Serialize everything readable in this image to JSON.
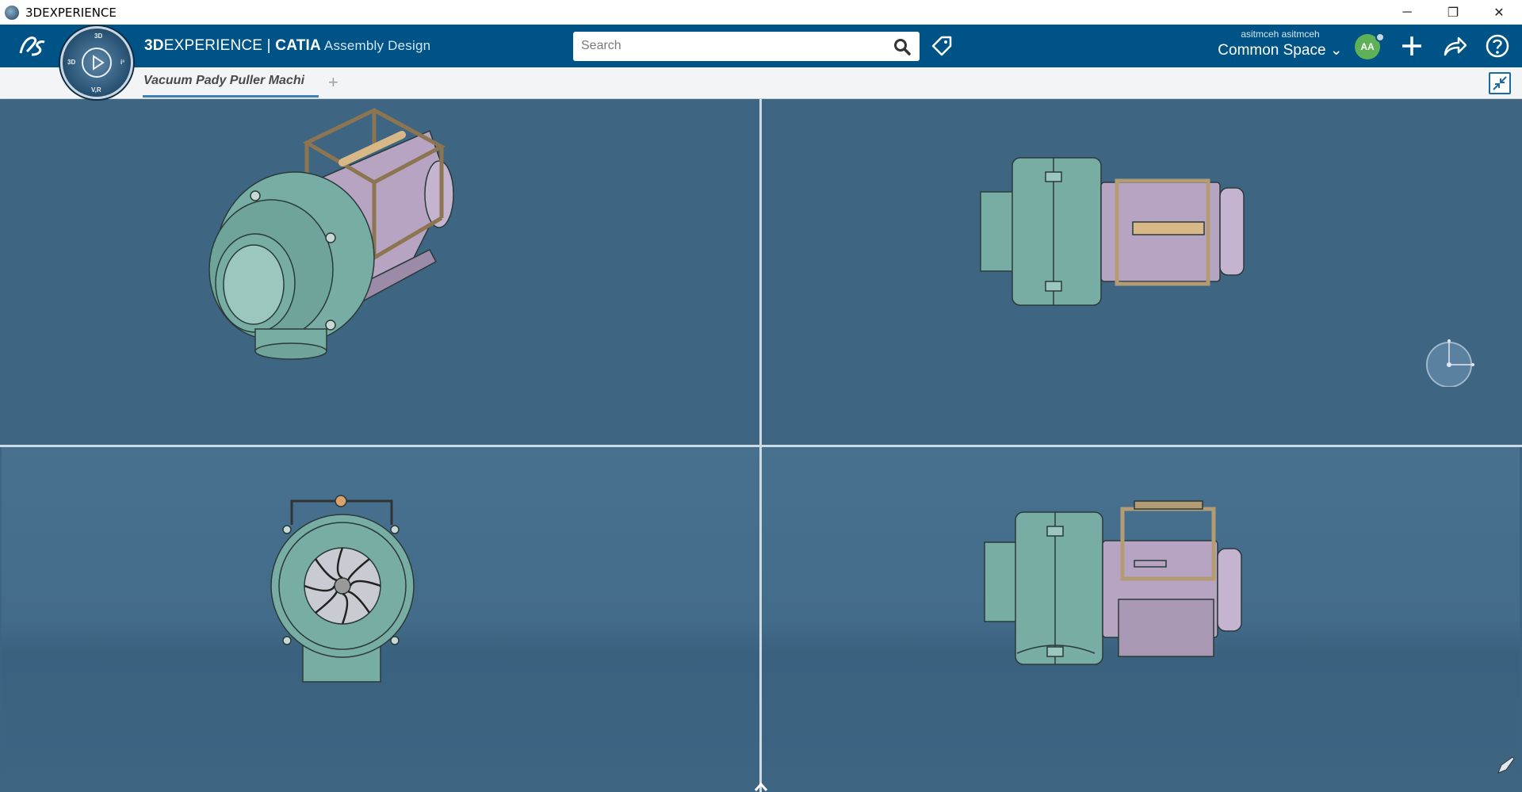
{
  "window": {
    "title": "3DEXPERIENCE",
    "minimize_label": "─",
    "restore_label": "❐",
    "close_label": "✕"
  },
  "topbar": {
    "brand_prefix": "3D",
    "brand_experience": "EXPERIENCE",
    "brand_separator": " | ",
    "brand_catia": "CATIA",
    "app_name": "Assembly Design",
    "search_placeholder": "Search",
    "user_name": "asitmceh asitmceh",
    "collab_space": "Common Space ⌄",
    "avatar_initials": "AA"
  },
  "compass": {
    "top_label": "3D",
    "right_label": "i³",
    "bottom_label": "V,R",
    "left_label": "3D"
  },
  "tabs": [
    {
      "label": "Vacuum Pady Puller Machi"
    }
  ],
  "tab_add_label": "+",
  "colors": {
    "topbar": "#005386",
    "viewport_background": "#3e6683",
    "housing_green": "#78ada3",
    "motor_lavender": "#b7a4c2",
    "frame_tan": "#b39b73"
  },
  "icons": {
    "search": "search-icon",
    "tag": "tag-icon",
    "add": "plus-icon",
    "share": "share-icon",
    "help": "help-icon",
    "collapse": "collapse-icon"
  }
}
